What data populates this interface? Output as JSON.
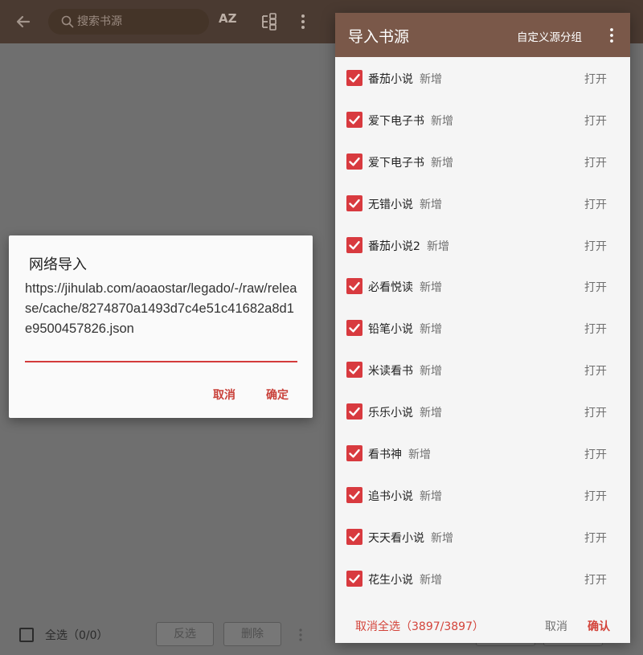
{
  "topbar": {
    "search_placeholder": "搜索书源",
    "back_icon": "arrow-left-icon",
    "sort_label": "AZ",
    "group_icon": "group-icon",
    "more_icon": "more-vert-icon"
  },
  "bottom_bar": {
    "select_all_label": "全选（0/0）",
    "invert_label": "反选",
    "delete_label": "删除"
  },
  "net_dialog": {
    "title": "网络导入",
    "url": "https://jihulab.com/aoaostar/legado/-/raw/release/cache/8274870a1493d7c4e51c41682a8d1e9500457826.json",
    "cancel_label": "取消",
    "ok_label": "确定"
  },
  "import_panel": {
    "title": "导入书源",
    "custom_group_label": "自定义源分组",
    "items": [
      {
        "name": "番茄小说",
        "status": "新增",
        "open": "打开"
      },
      {
        "name": "爱下电子书",
        "status": "新增",
        "open": "打开"
      },
      {
        "name": "爱下电子书",
        "status": "新增",
        "open": "打开"
      },
      {
        "name": "无错小说",
        "status": "新增",
        "open": "打开"
      },
      {
        "name": "番茄小说2",
        "status": "新增",
        "open": "打开"
      },
      {
        "name": "必看悦读",
        "status": "新增",
        "open": "打开"
      },
      {
        "name": "铅笔小说",
        "status": "新增",
        "open": "打开"
      },
      {
        "name": "米读看书",
        "status": "新增",
        "open": "打开"
      },
      {
        "name": "乐乐小说",
        "status": "新增",
        "open": "打开"
      },
      {
        "name": "看书神",
        "status": "新增",
        "open": "打开"
      },
      {
        "name": "追书小说",
        "status": "新增",
        "open": "打开"
      },
      {
        "name": "天天看小说",
        "status": "新增",
        "open": "打开"
      },
      {
        "name": "花生小说",
        "status": "新增",
        "open": "打开"
      }
    ],
    "deselect_all_label": "取消全选（3897/3897）",
    "cancel_label": "取消",
    "confirm_label": "确认"
  },
  "colors": {
    "accent_red": "#d83a3f",
    "panel_header": "#7a5849",
    "app_topbar": "#4a3a31"
  }
}
